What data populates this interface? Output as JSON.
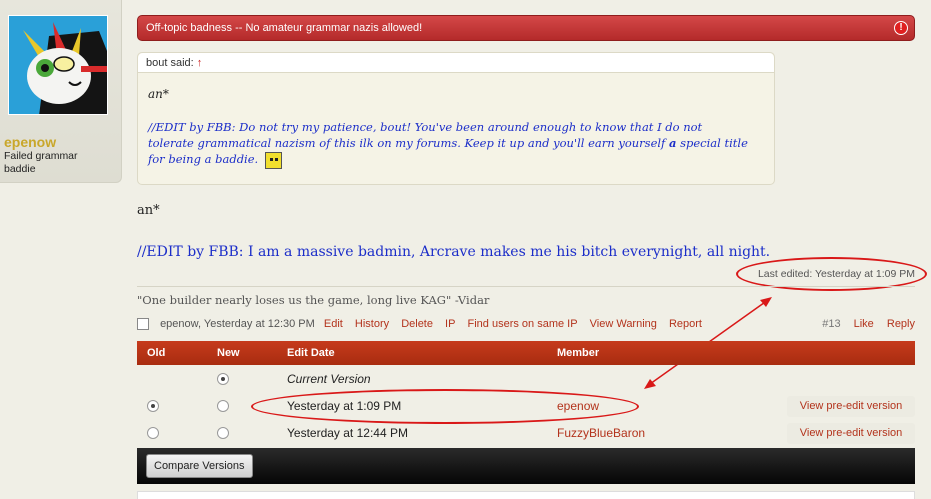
{
  "user": {
    "name": "epenow",
    "title": "Failed grammar baddie"
  },
  "moderator_notice": {
    "text": "Off-topic badness -- No amateur grammar nazis allowed!",
    "icon": "exclamation-icon"
  },
  "quote": {
    "header": "bout said:",
    "arrow": "↑",
    "line1": "an*",
    "line2": "//EDIT by FBB: Do not try my patience, bout! You've been around enough to know that I do not tolerate grammatical nazism of this ilk on my forums. Keep it up and you'll earn yourself",
    "line2_bold": "a",
    "line2_end": "special title for being a baddie."
  },
  "post": {
    "text1": "an*",
    "text2": "//EDIT by FBB: I am a massive badmin, Arcrave makes me his bitch everynight, all night.",
    "last_edited": "Last edited: Yesterday at 1:09 PM",
    "signature": "\"One builder nearly loses us the game, long live KAG\" -Vidar"
  },
  "meta": {
    "author_time": "epenow, Yesterday at 12:30 PM",
    "links": [
      "Edit",
      "History",
      "Delete",
      "IP",
      "Find users on same IP",
      "View Warning",
      "Report"
    ],
    "post_number": "#13",
    "like": "Like",
    "reply": "Reply"
  },
  "history": {
    "columns": [
      "Old",
      "New",
      "Edit Date",
      "Member"
    ],
    "rows": [
      {
        "date": "Current Version",
        "member": "",
        "button": "",
        "old": "",
        "new": "selected"
      },
      {
        "date": "Yesterday at 1:09 PM",
        "member": "epenow",
        "button": "View pre-edit version",
        "old": "selected",
        "new": ""
      },
      {
        "date": "Yesterday at 12:44 PM",
        "member": "FuzzyBlueBaron",
        "button": "View pre-edit version",
        "old": "",
        "new": ""
      }
    ],
    "compare_button": "Compare Versions"
  },
  "colors": {
    "accent": "#b3331c",
    "header_red": "#c63b1c",
    "edit_blue": "#1c2ec9",
    "annotation_red": "#d91818",
    "username_gold": "#c9a72a"
  }
}
